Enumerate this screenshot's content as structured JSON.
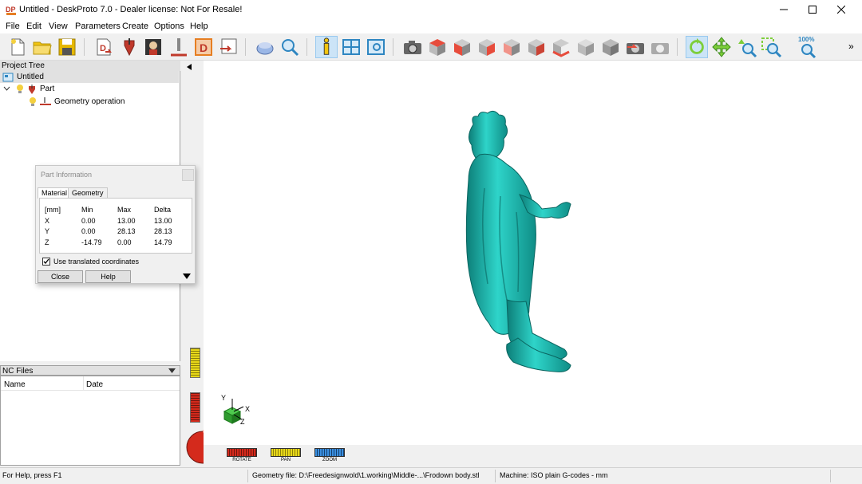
{
  "window": {
    "title": "Untitled - DeskProto 7.0 - Dealer license: Not For Resale!",
    "icon": "dp-app-icon"
  },
  "menu": [
    "File",
    "Edit",
    "View",
    "Parameters",
    "Create",
    "Options",
    "Help"
  ],
  "toolbar": {
    "zoom_label": "100%",
    "overflow": "»",
    "icons": [
      "new-icon",
      "open-icon",
      "save-icon",
      "import-geometry-icon",
      "part-icon",
      "bitmap-icon",
      "operation-icon",
      "drawing-icon",
      "export-icon",
      "material-icon",
      "zoom-part-icon",
      "info-icon",
      "layout-icon",
      "preview-icon",
      "camera-icon",
      "view-top-icon",
      "view-front-icon",
      "view-right-icon",
      "view-left-icon",
      "view-back-icon",
      "view-bottom-icon",
      "view-iso-icon",
      "view-iso2-icon",
      "render-icon",
      "render-settings-icon",
      "rotate-mode-icon",
      "pan-mode-icon",
      "zoom-mode-icon",
      "zoom-window-icon",
      "zoom-fit-icon"
    ]
  },
  "project_tree": {
    "header": "Project Tree",
    "root": "Untitled",
    "part": "Part",
    "operation": "Geometry operation"
  },
  "nc_files": {
    "header": "NC Files",
    "columns": [
      "Name",
      "Date"
    ]
  },
  "part_info": {
    "title": "Part Information",
    "tabs": [
      "Material",
      "Geometry"
    ],
    "columns": [
      "[mm]",
      "Min",
      "Max",
      "Delta"
    ],
    "rows": [
      {
        "axis": "X",
        "min": "0.00",
        "max": "13.00",
        "delta": "13.00"
      },
      {
        "axis": "Y",
        "min": "0.00",
        "max": "28.13",
        "delta": "28.13"
      },
      {
        "axis": "Z",
        "min": "-14.79",
        "max": "0.00",
        "delta": "14.79"
      }
    ],
    "checkbox_label": "Use translated coordinates",
    "checkbox_checked": true,
    "close_label": "Close",
    "help_label": "Help"
  },
  "axes": {
    "x": "X",
    "y": "Y",
    "z": "Z"
  },
  "view_controls": {
    "rotate": "ROTATE",
    "pan": "PAN",
    "zoom": "ZOOM"
  },
  "status": {
    "help": "For Help, press F1",
    "geometry": "Geometry file: D:\\Freedesignwold\\1.working\\Middle-...\\Frodown body.stl",
    "machine": "Machine: ISO plain G-codes - mm"
  },
  "colors": {
    "model": "#1fb9b0",
    "model_dark": "#0d7e78",
    "rotate": "#d42a1c",
    "pan": "#e8d81a",
    "zoom": "#3a8fe0"
  }
}
